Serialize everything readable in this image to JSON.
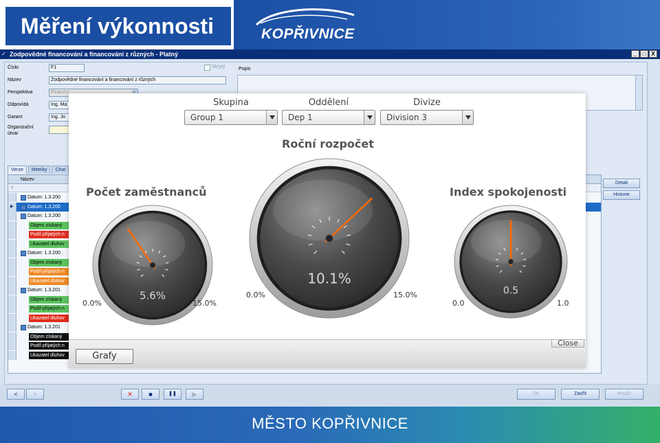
{
  "slide": {
    "title": "Měření výkonnosti",
    "logo_text": "KOPŘIVNICE",
    "footer": "MĚSTO KOPŘIVNICE"
  },
  "window": {
    "title": "Zodpovědné financování a financování z různých - Platný",
    "controls": [
      "_",
      "□",
      "X"
    ]
  },
  "form": {
    "cislo_label": "Číslo",
    "cislo_value": "F1",
    "nazev_label": "Název",
    "nazev_value": "Zodpovědné financování a financování z různých",
    "perspektiva_label": "Perspektiva",
    "perspektiva_value": "Finanční",
    "odpovida_label": "Odpovídá",
    "odpovida_value": "Ing. Ma",
    "garant_label": "Garant",
    "garant_value": "Ing. Jo",
    "org_label_1": "Organizační",
    "org_label_2": "útvar",
    "skryty_label": "Skrytý",
    "popis_label": "Popis"
  },
  "tabs": [
    "Verze",
    "Metriky",
    "Chat"
  ],
  "grid": {
    "column": "Název",
    "rows": [
      {
        "type": "date",
        "text": "Datum: 1.3.200"
      },
      {
        "type": "date",
        "text": "Datum: 1.3.200",
        "selected": true
      },
      {
        "type": "date",
        "text": "Datum: 1.3.200"
      },
      {
        "type": "metric",
        "text": "Objem získaný",
        "color": "green"
      },
      {
        "type": "metric",
        "text": "Podíl přijatých n",
        "color": "red"
      },
      {
        "type": "metric",
        "text": "Ukazatel dluhov",
        "color": "green"
      },
      {
        "type": "date",
        "text": "Datum: 1.3.200"
      },
      {
        "type": "metric",
        "text": "Objem získaný",
        "color": "green"
      },
      {
        "type": "metric",
        "text": "Podíl přijatých n",
        "color": "orange"
      },
      {
        "type": "metric",
        "text": "Ukazatel dluhov",
        "color": "orange"
      },
      {
        "type": "date",
        "text": "Datum: 1.3.201"
      },
      {
        "type": "metric",
        "text": "Objem získaný",
        "color": "green"
      },
      {
        "type": "metric",
        "text": "Podíl přijatých n",
        "color": "green"
      },
      {
        "type": "metric",
        "text": "Ukazatel dluhov",
        "color": "red"
      },
      {
        "type": "date",
        "text": "Datum: 1.3.201"
      },
      {
        "type": "metric",
        "text": "Objem získaný",
        "color": "black"
      },
      {
        "type": "metric",
        "text": "Podíl přijatých n",
        "color": "black"
      },
      {
        "type": "metric",
        "text": "Ukazatel dluhov",
        "color": "black"
      }
    ]
  },
  "side_buttons": {
    "detail": "Detail",
    "historie": "Historie"
  },
  "bottom": {
    "prev": "<",
    "next": ">",
    "cancel": "✕",
    "stop": "■",
    "pause": "❚❚",
    "play": "▶",
    "ok": "OK",
    "zavrit": "Zavřít",
    "pouzit": "Použít"
  },
  "dashboard": {
    "filters": [
      {
        "label": "Skupina",
        "value": "Group 1"
      },
      {
        "label": "Oddělení",
        "value": "Dep 1"
      },
      {
        "label": "Divize",
        "value": "Division 3"
      }
    ],
    "gauges": [
      {
        "title": "Počet zaměstnanců",
        "value_text": "5.6%",
        "value": 5.6,
        "min": 0,
        "max": 15,
        "min_text": "0.0%",
        "max_text": "15.0%"
      },
      {
        "title": "Roční rozpočet",
        "value_text": "10.1%",
        "value": 10.1,
        "min": 0,
        "max": 15,
        "min_text": "0.0%",
        "max_text": "15.0%"
      },
      {
        "title": "Index spokojenosti",
        "value_text": "0.5",
        "value": 0.5,
        "min": 0,
        "max": 1,
        "min_text": "0.0",
        "max_text": "1.0"
      }
    ],
    "close_label": "Close",
    "grafy_label": "Grafy"
  },
  "colors": {
    "brand_blue": "#1b4fa3",
    "titlebar": "#0a2f79",
    "needle": "#ff6a00",
    "status_green": "#5dc35f",
    "status_red": "#e02d1f",
    "status_orange": "#f08a28"
  }
}
